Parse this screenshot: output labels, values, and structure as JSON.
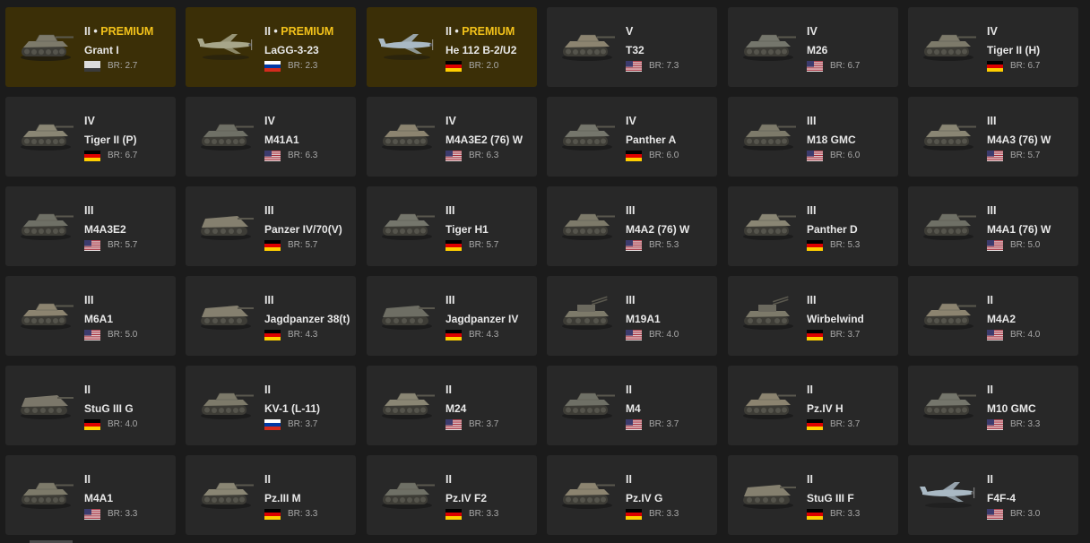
{
  "colors": {
    "background": "#1b1b1b",
    "card": "#282828",
    "premium_card": "#3b2f07",
    "premium_accent": "#f3c21a"
  },
  "vehicles": [
    {
      "rank": "II",
      "premium_label": "PREMIUM",
      "premium": true,
      "name": "Grant I",
      "nation": "uk-flag-icon",
      "br": "BR: 2.7",
      "kind": "tank-icon"
    },
    {
      "rank": "II",
      "premium_label": "PREMIUM",
      "premium": true,
      "name": "LaGG-3-23",
      "nation": "ussr-flag-icon",
      "br": "BR: 2.3",
      "kind": "plane-icon"
    },
    {
      "rank": "II",
      "premium_label": "PREMIUM",
      "premium": true,
      "name": "He 112 B-2/U2",
      "nation": "germany-flag-icon",
      "br": "BR: 2.0",
      "kind": "plane-icon"
    },
    {
      "rank": "V",
      "premium": false,
      "name": "T32",
      "nation": "usa-flag-icon",
      "br": "BR: 7.3",
      "kind": "tank-icon"
    },
    {
      "rank": "IV",
      "premium": false,
      "name": "M26",
      "nation": "usa-flag-icon",
      "br": "BR: 6.7",
      "kind": "tank-icon"
    },
    {
      "rank": "IV",
      "premium": false,
      "name": "Tiger II (H)",
      "nation": "germany-flag-icon",
      "br": "BR: 6.7",
      "kind": "tank-icon"
    },
    {
      "rank": "IV",
      "premium": false,
      "name": "Tiger II (P)",
      "nation": "germany-flag-icon",
      "br": "BR: 6.7",
      "kind": "tank-icon"
    },
    {
      "rank": "IV",
      "premium": false,
      "name": "M41A1",
      "nation": "usa-flag-icon",
      "br": "BR: 6.3",
      "kind": "tank-icon"
    },
    {
      "rank": "IV",
      "premium": false,
      "name": "M4A3E2 (76) W",
      "nation": "usa-flag-icon",
      "br": "BR: 6.3",
      "kind": "tank-icon"
    },
    {
      "rank": "IV",
      "premium": false,
      "name": "Panther A",
      "nation": "germany-flag-icon",
      "br": "BR: 6.0",
      "kind": "tank-icon"
    },
    {
      "rank": "III",
      "premium": false,
      "name": "M18 GMC",
      "nation": "usa-flag-icon",
      "br": "BR: 6.0",
      "kind": "tank-icon"
    },
    {
      "rank": "III",
      "premium": false,
      "name": "M4A3 (76) W",
      "nation": "usa-flag-icon",
      "br": "BR: 5.7",
      "kind": "tank-icon"
    },
    {
      "rank": "III",
      "premium": false,
      "name": "M4A3E2",
      "nation": "usa-flag-icon",
      "br": "BR: 5.7",
      "kind": "tank-icon"
    },
    {
      "rank": "III",
      "premium": false,
      "name": "Panzer IV/70(V)",
      "nation": "germany-flag-icon",
      "br": "BR: 5.7",
      "kind": "tank-destroyer-icon"
    },
    {
      "rank": "III",
      "premium": false,
      "name": "Tiger H1",
      "nation": "germany-flag-icon",
      "br": "BR: 5.7",
      "kind": "tank-icon"
    },
    {
      "rank": "III",
      "premium": false,
      "name": "M4A2 (76) W",
      "nation": "usa-flag-icon",
      "br": "BR: 5.3",
      "kind": "tank-icon"
    },
    {
      "rank": "III",
      "premium": false,
      "name": "Panther D",
      "nation": "germany-flag-icon",
      "br": "BR: 5.3",
      "kind": "tank-icon"
    },
    {
      "rank": "III",
      "premium": false,
      "name": "M4A1 (76) W",
      "nation": "usa-flag-icon",
      "br": "BR: 5.0",
      "kind": "tank-icon"
    },
    {
      "rank": "III",
      "premium": false,
      "name": "M6A1",
      "nation": "usa-flag-icon",
      "br": "BR: 5.0",
      "kind": "tank-icon"
    },
    {
      "rank": "III",
      "premium": false,
      "name": "Jagdpanzer 38(t)",
      "nation": "germany-flag-icon",
      "br": "BR: 4.3",
      "kind": "tank-destroyer-icon"
    },
    {
      "rank": "III",
      "premium": false,
      "name": "Jagdpanzer IV",
      "nation": "germany-flag-icon",
      "br": "BR: 4.3",
      "kind": "tank-destroyer-icon"
    },
    {
      "rank": "III",
      "premium": false,
      "name": "M19A1",
      "nation": "usa-flag-icon",
      "br": "BR: 4.0",
      "kind": "spaa-icon"
    },
    {
      "rank": "III",
      "premium": false,
      "name": "Wirbelwind",
      "nation": "germany-flag-icon",
      "br": "BR: 3.7",
      "kind": "spaa-icon"
    },
    {
      "rank": "II",
      "premium": false,
      "name": "M4A2",
      "nation": "usa-flag-icon",
      "br": "BR: 4.0",
      "kind": "tank-icon"
    },
    {
      "rank": "II",
      "premium": false,
      "name": "StuG III G",
      "nation": "germany-flag-icon",
      "br": "BR: 4.0",
      "kind": "tank-destroyer-icon"
    },
    {
      "rank": "II",
      "premium": false,
      "name": "KV-1 (L-11)",
      "nation": "ussr-flag-icon",
      "br": "BR: 3.7",
      "kind": "tank-icon"
    },
    {
      "rank": "II",
      "premium": false,
      "name": "M24",
      "nation": "usa-flag-icon",
      "br": "BR: 3.7",
      "kind": "tank-icon"
    },
    {
      "rank": "II",
      "premium": false,
      "name": "M4",
      "nation": "usa-flag-icon",
      "br": "BR: 3.7",
      "kind": "tank-icon"
    },
    {
      "rank": "II",
      "premium": false,
      "name": "Pz.IV H",
      "nation": "germany-flag-icon",
      "br": "BR: 3.7",
      "kind": "tank-icon"
    },
    {
      "rank": "II",
      "premium": false,
      "name": "M10 GMC",
      "nation": "usa-flag-icon",
      "br": "BR: 3.3",
      "kind": "tank-icon"
    },
    {
      "rank": "II",
      "premium": false,
      "name": "M4A1",
      "nation": "usa-flag-icon",
      "br": "BR: 3.3",
      "kind": "tank-icon"
    },
    {
      "rank": "II",
      "premium": false,
      "name": "Pz.III M",
      "nation": "germany-flag-icon",
      "br": "BR: 3.3",
      "kind": "tank-icon"
    },
    {
      "rank": "II",
      "premium": false,
      "name": "Pz.IV F2",
      "nation": "germany-flag-icon",
      "br": "BR: 3.3",
      "kind": "tank-icon"
    },
    {
      "rank": "II",
      "premium": false,
      "name": "Pz.IV G",
      "nation": "germany-flag-icon",
      "br": "BR: 3.3",
      "kind": "tank-icon"
    },
    {
      "rank": "II",
      "premium": false,
      "name": "StuG III F",
      "nation": "germany-flag-icon",
      "br": "BR: 3.3",
      "kind": "tank-destroyer-icon"
    },
    {
      "rank": "II",
      "premium": false,
      "name": "F4F-4",
      "nation": "usa-flag-icon",
      "br": "BR: 3.0",
      "kind": "plane-icon"
    }
  ]
}
